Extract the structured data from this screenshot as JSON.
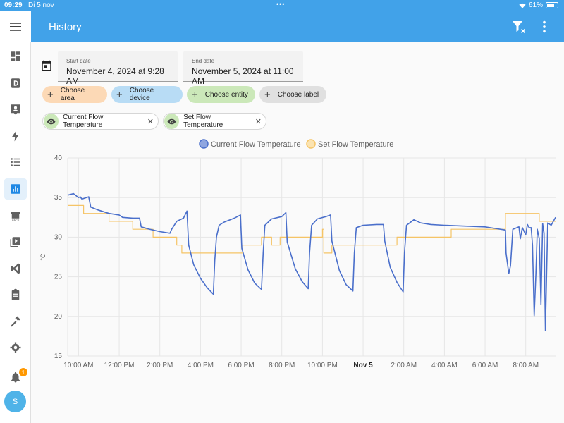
{
  "status_bar": {
    "time": "09:29",
    "date": "Di 5 nov",
    "battery": "61%"
  },
  "app_bar": {
    "title": "History",
    "filter_icon": "filter-remove-icon",
    "more_icon": "dots-vertical-icon"
  },
  "sidebar": {
    "menu_icon": "hamburger-menu-icon",
    "items": [
      {
        "name": "overview",
        "icon": "dashboard-icon",
        "active": false
      },
      {
        "name": "d-panel",
        "icon": "d-square-icon",
        "active": false
      },
      {
        "name": "person-panel",
        "icon": "account-box-icon",
        "active": false
      },
      {
        "name": "energy",
        "icon": "lightning-icon",
        "active": false
      },
      {
        "name": "logbook",
        "icon": "list-icon",
        "active": false
      },
      {
        "name": "history",
        "icon": "chart-box-icon",
        "active": true
      },
      {
        "name": "hacs",
        "icon": "hacs-icon",
        "active": false
      },
      {
        "name": "media",
        "icon": "play-box-icon",
        "active": false
      },
      {
        "name": "vscode",
        "icon": "vscode-icon",
        "active": false
      },
      {
        "name": "todo",
        "icon": "clipboard-icon",
        "active": false
      },
      {
        "name": "developer-tools",
        "icon": "hammer-icon",
        "active": false
      },
      {
        "name": "settings",
        "icon": "cog-icon",
        "active": false
      }
    ],
    "notifications_icon": "bell-icon",
    "notification_count": "1",
    "avatar_initial": "S"
  },
  "filters": {
    "start_label": "Start date",
    "start_value": "November 4, 2024 at 9:28 AM",
    "end_label": "End date",
    "end_value": "November 5, 2024 at 11:00 AM",
    "chips": {
      "area": "Choose area",
      "device": "Choose device",
      "entity": "Choose entity",
      "label": "Choose label"
    },
    "selected": [
      {
        "label": "Current Flow Temperature",
        "icon": "eye-icon"
      },
      {
        "label": "Set Flow Temperature",
        "icon": "eye-icon"
      }
    ]
  },
  "chart_data": {
    "type": "line",
    "ylabel": "°C",
    "ylim": [
      15,
      40
    ],
    "yticks": [
      15,
      20,
      25,
      30,
      35,
      40
    ],
    "xlim": [
      "2024-11-04 09:28",
      "2024-11-05 09:28"
    ],
    "xticks": [
      {
        "t": "2024-11-04 10:00",
        "label": "10:00 AM",
        "bold": false
      },
      {
        "t": "2024-11-04 12:00",
        "label": "12:00 PM",
        "bold": false
      },
      {
        "t": "2024-11-04 14:00",
        "label": "2:00 PM",
        "bold": false
      },
      {
        "t": "2024-11-04 16:00",
        "label": "4:00 PM",
        "bold": false
      },
      {
        "t": "2024-11-04 18:00",
        "label": "6:00 PM",
        "bold": false
      },
      {
        "t": "2024-11-04 20:00",
        "label": "8:00 PM",
        "bold": false
      },
      {
        "t": "2024-11-04 22:00",
        "label": "10:00 PM",
        "bold": false
      },
      {
        "t": "2024-11-05 00:00",
        "label": "Nov 5",
        "bold": true
      },
      {
        "t": "2024-11-05 02:00",
        "label": "2:00 AM",
        "bold": false
      },
      {
        "t": "2024-11-05 04:00",
        "label": "4:00 AM",
        "bold": false
      },
      {
        "t": "2024-11-05 06:00",
        "label": "6:00 AM",
        "bold": false
      },
      {
        "t": "2024-11-05 08:00",
        "label": "8:00 AM",
        "bold": false
      }
    ],
    "grid": true,
    "legend": "top-center",
    "series": [
      {
        "name": "Current Flow Temperature",
        "color": "#4a6fcb",
        "step": false,
        "points": [
          [
            "2024-11-04 09:28",
            35.3
          ],
          [
            "2024-11-04 09:45",
            35.5
          ],
          [
            "2024-11-04 10:00",
            35.0
          ],
          [
            "2024-11-04 10:05",
            35.1
          ],
          [
            "2024-11-04 10:10",
            34.8
          ],
          [
            "2024-11-04 10:30",
            35.1
          ],
          [
            "2024-11-04 10:36",
            33.8
          ],
          [
            "2024-11-04 11:00",
            33.4
          ],
          [
            "2024-11-04 11:30",
            33.0
          ],
          [
            "2024-11-04 12:00",
            32.8
          ],
          [
            "2024-11-04 12:10",
            32.5
          ],
          [
            "2024-11-04 12:40",
            32.4
          ],
          [
            "2024-11-04 13:00",
            32.4
          ],
          [
            "2024-11-04 13:05",
            31.3
          ],
          [
            "2024-11-04 13:30",
            31.0
          ],
          [
            "2024-11-04 14:00",
            30.7
          ],
          [
            "2024-11-04 14:30",
            30.5
          ],
          [
            "2024-11-04 14:35",
            31.0
          ],
          [
            "2024-11-04 14:50",
            32.0
          ],
          [
            "2024-11-04 15:10",
            32.4
          ],
          [
            "2024-11-04 15:20",
            33.3
          ],
          [
            "2024-11-04 15:25",
            29.0
          ],
          [
            "2024-11-04 15:40",
            26.5
          ],
          [
            "2024-11-04 16:00",
            24.8
          ],
          [
            "2024-11-04 16:20",
            23.6
          ],
          [
            "2024-11-04 16:38",
            22.8
          ],
          [
            "2024-11-04 16:42",
            27.0
          ],
          [
            "2024-11-04 16:47",
            30.0
          ],
          [
            "2024-11-04 16:55",
            31.5
          ],
          [
            "2024-11-04 17:10",
            31.9
          ],
          [
            "2024-11-04 17:40",
            32.4
          ],
          [
            "2024-11-04 17:58",
            32.8
          ],
          [
            "2024-11-04 18:02",
            28.6
          ],
          [
            "2024-11-04 18:20",
            25.9
          ],
          [
            "2024-11-04 18:40",
            24.2
          ],
          [
            "2024-11-04 19:00",
            23.4
          ],
          [
            "2024-11-04 19:05",
            28.0
          ],
          [
            "2024-11-04 19:10",
            31.5
          ],
          [
            "2024-11-04 19:30",
            32.3
          ],
          [
            "2024-11-04 20:00",
            32.6
          ],
          [
            "2024-11-04 20:12",
            33.1
          ],
          [
            "2024-11-04 20:16",
            29.4
          ],
          [
            "2024-11-04 20:40",
            26.0
          ],
          [
            "2024-11-04 21:00",
            24.4
          ],
          [
            "2024-11-04 21:18",
            23.5
          ],
          [
            "2024-11-04 21:22",
            28.0
          ],
          [
            "2024-11-04 21:28",
            31.5
          ],
          [
            "2024-11-04 21:45",
            32.3
          ],
          [
            "2024-11-04 22:10",
            32.6
          ],
          [
            "2024-11-04 22:24",
            32.8
          ],
          [
            "2024-11-04 22:28",
            29.5
          ],
          [
            "2024-11-04 22:50",
            25.8
          ],
          [
            "2024-11-04 23:10",
            24.0
          ],
          [
            "2024-11-04 23:30",
            23.2
          ],
          [
            "2024-11-04 23:34",
            28.0
          ],
          [
            "2024-11-04 23:40",
            31.2
          ],
          [
            "2024-11-05 00:00",
            31.5
          ],
          [
            "2024-11-05 00:40",
            31.6
          ],
          [
            "2024-11-05 01:00",
            31.6
          ],
          [
            "2024-11-05 01:04",
            29.5
          ],
          [
            "2024-11-05 01:20",
            26.2
          ],
          [
            "2024-11-05 01:40",
            24.3
          ],
          [
            "2024-11-05 01:58",
            23.1
          ],
          [
            "2024-11-05 02:02",
            28.0
          ],
          [
            "2024-11-05 02:08",
            31.5
          ],
          [
            "2024-11-05 02:30",
            32.2
          ],
          [
            "2024-11-05 02:50",
            31.8
          ],
          [
            "2024-11-05 03:20",
            31.6
          ],
          [
            "2024-11-05 04:00",
            31.5
          ],
          [
            "2024-11-05 05:00",
            31.4
          ],
          [
            "2024-11-05 06:00",
            31.3
          ],
          [
            "2024-11-05 06:30",
            31.1
          ],
          [
            "2024-11-05 07:00",
            30.9
          ],
          [
            "2024-11-05 07:02",
            28.0
          ],
          [
            "2024-11-05 07:10",
            25.4
          ],
          [
            "2024-11-05 07:15",
            26.4
          ],
          [
            "2024-11-05 07:22",
            31.0
          ],
          [
            "2024-11-05 07:40",
            31.3
          ],
          [
            "2024-11-05 07:44",
            29.8
          ],
          [
            "2024-11-05 07:50",
            31.2
          ],
          [
            "2024-11-05 08:00",
            30.3
          ],
          [
            "2024-11-05 08:05",
            31.6
          ],
          [
            "2024-11-05 08:10",
            31.2
          ],
          [
            "2024-11-05 08:16",
            31.2
          ],
          [
            "2024-11-05 08:20",
            29.0
          ],
          [
            "2024-11-05 08:25",
            20.1
          ],
          [
            "2024-11-05 08:30",
            25.3
          ],
          [
            "2024-11-05 08:34",
            31.0
          ],
          [
            "2024-11-05 08:40",
            29.8
          ],
          [
            "2024-11-05 08:45",
            21.5
          ],
          [
            "2024-11-05 08:50",
            31.7
          ],
          [
            "2024-11-05 08:54",
            30.5
          ],
          [
            "2024-11-05 08:58",
            18.2
          ],
          [
            "2024-11-05 09:05",
            31.8
          ],
          [
            "2024-11-05 09:15",
            31.5
          ],
          [
            "2024-11-05 09:28",
            32.5
          ]
        ]
      },
      {
        "name": "Set Flow Temperature",
        "color": "#f5c466",
        "step": true,
        "points": [
          [
            "2024-11-04 09:28",
            34.0
          ],
          [
            "2024-11-04 10:15",
            33.0
          ],
          [
            "2024-11-04 11:30",
            32.0
          ],
          [
            "2024-11-04 12:40",
            31.0
          ],
          [
            "2024-11-04 13:40",
            30.0
          ],
          [
            "2024-11-04 14:50",
            29.0
          ],
          [
            "2024-11-04 15:05",
            28.0
          ],
          [
            "2024-11-04 18:05",
            29.0
          ],
          [
            "2024-11-04 19:00",
            30.0
          ],
          [
            "2024-11-04 19:30",
            29.0
          ],
          [
            "2024-11-04 19:55",
            30.0
          ],
          [
            "2024-11-04 22:00",
            31.0
          ],
          [
            "2024-11-04 22:04",
            28.0
          ],
          [
            "2024-11-04 22:28",
            29.0
          ],
          [
            "2024-11-05 01:40",
            30.0
          ],
          [
            "2024-11-05 04:20",
            31.0
          ],
          [
            "2024-11-05 07:00",
            33.0
          ],
          [
            "2024-11-05 08:40",
            32.0
          ],
          [
            "2024-11-05 09:28",
            32.0
          ]
        ]
      }
    ]
  }
}
